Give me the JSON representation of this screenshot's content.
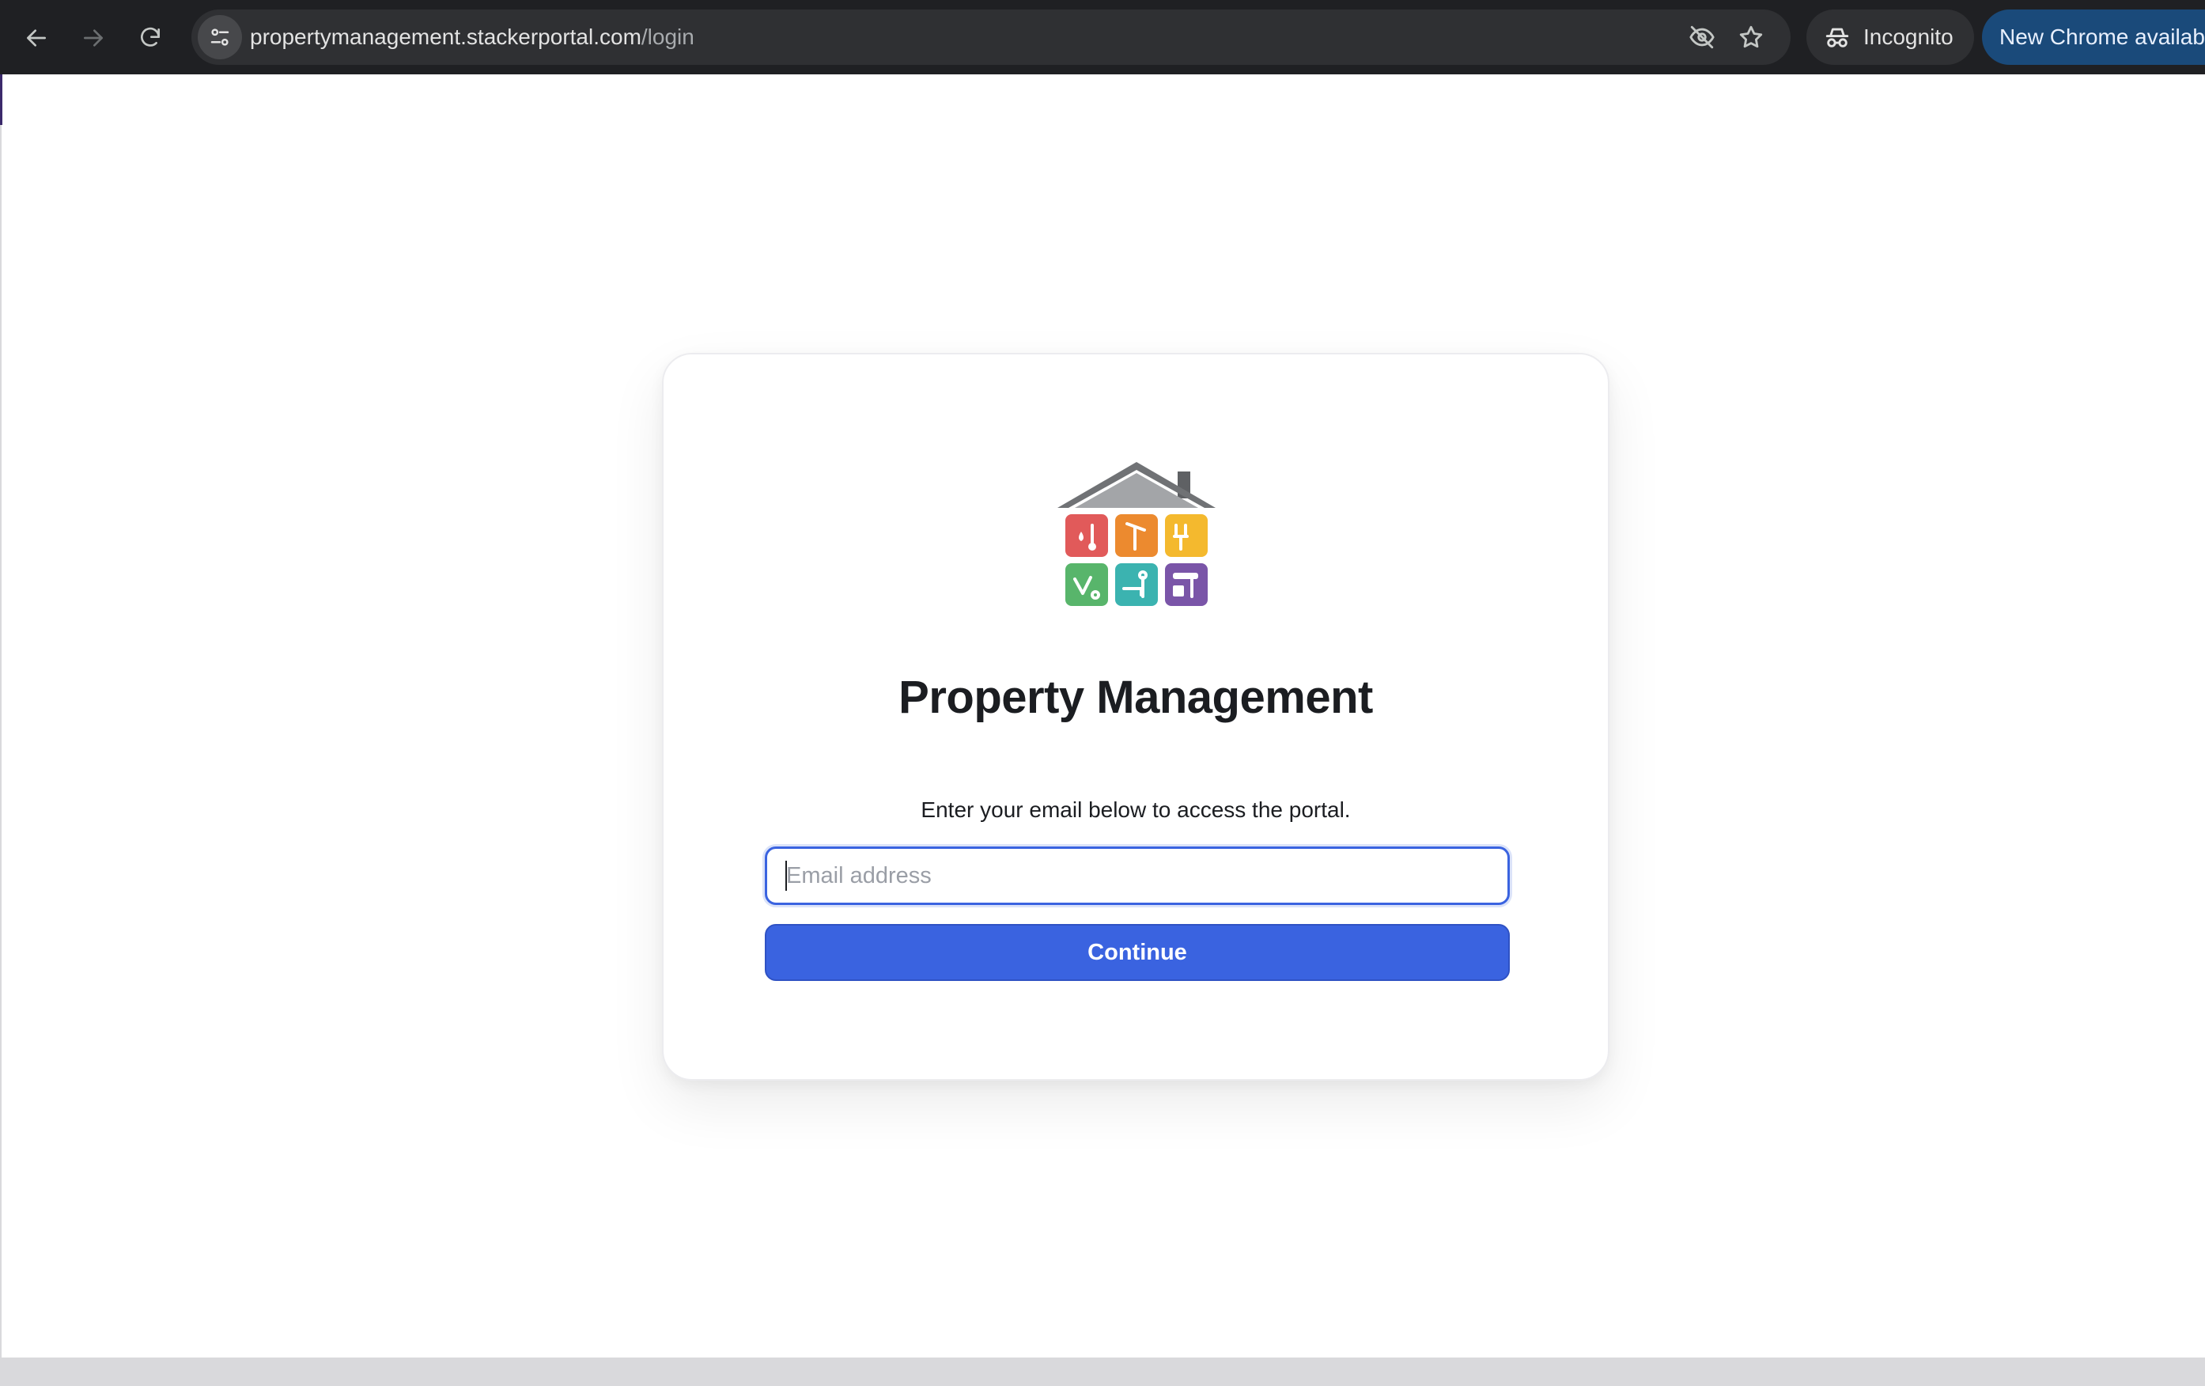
{
  "browser": {
    "url_host": "propertymanagement.stackerportal.com",
    "url_path": "/login",
    "incognito_label": "Incognito",
    "update_label": "New Chrome available",
    "icons": {
      "back": "arrow-left-icon",
      "forward": "arrow-right-icon",
      "reload": "reload-icon",
      "site_info": "tune-icon",
      "eye_off": "eye-off-icon",
      "bookmark": "star-icon",
      "incognito": "incognito-icon"
    }
  },
  "login": {
    "logo_icon": "house-tools-logo",
    "title": "Property Management",
    "subtitle": "Enter your email below to access the portal.",
    "email_value": "",
    "email_placeholder": "Email address",
    "continue_label": "Continue"
  },
  "colors": {
    "primary": "#3a63e0",
    "text": "#1b1d21",
    "chrome_bg": "#1f2023",
    "omnibox_bg": "#2f3033",
    "update_chip": "#1a4a7a",
    "logo_tiles": [
      "#e15a5a",
      "#ec8a2f",
      "#f4b92e",
      "#58b56b",
      "#3bb3b0",
      "#7a55a8"
    ],
    "roof": "#a3a5a8"
  }
}
